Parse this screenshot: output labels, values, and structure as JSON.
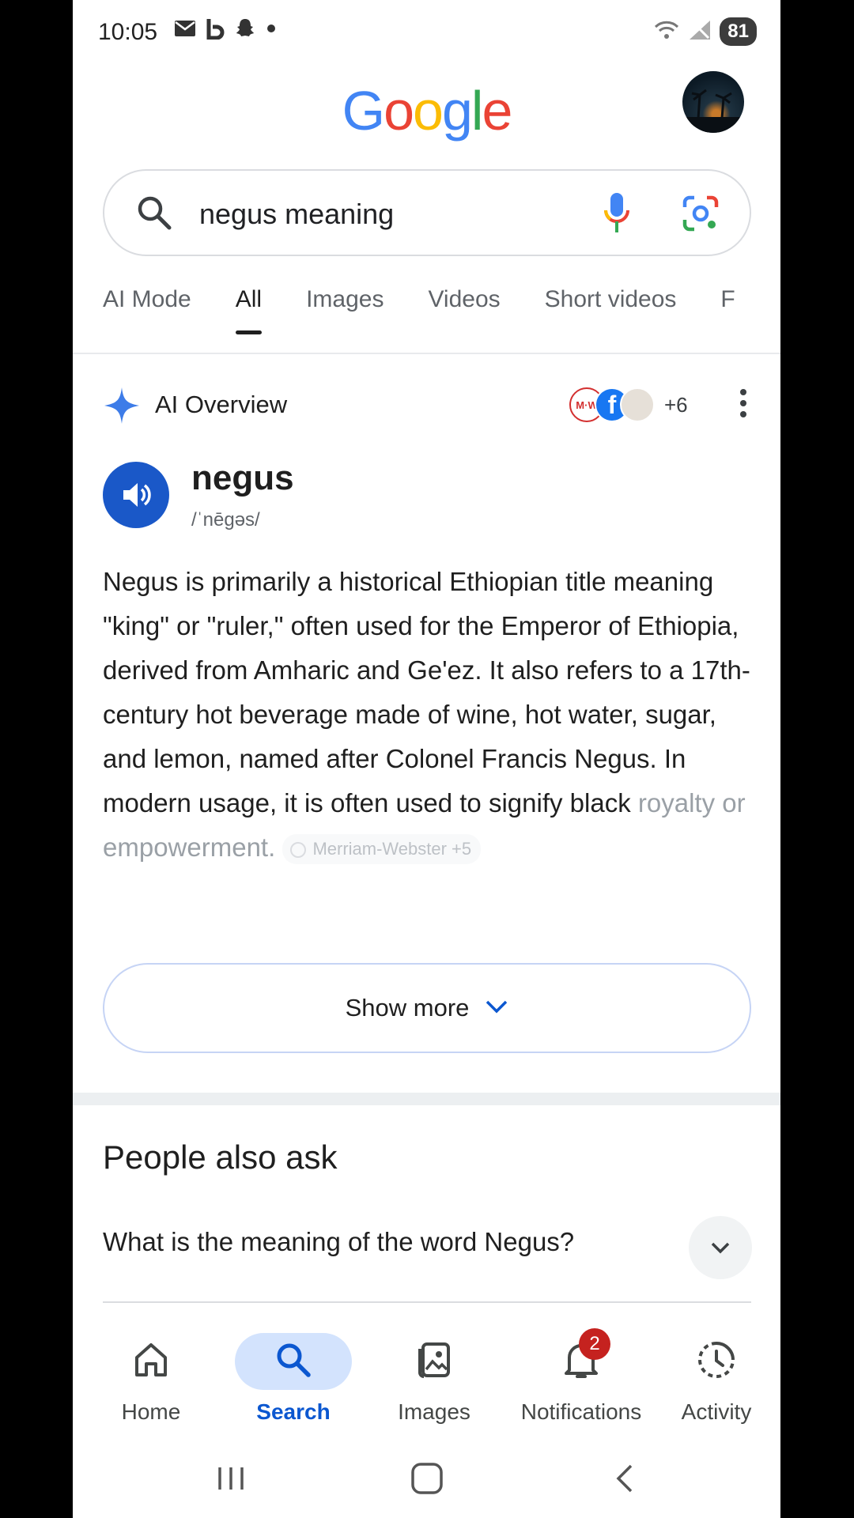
{
  "status_bar": {
    "time": "10:05",
    "battery": "81",
    "left_icons": [
      "mail-icon",
      "b-app-icon",
      "snapchat-icon",
      "dot-icon"
    ],
    "right_icons": [
      "wifi-icon",
      "signal-icon"
    ]
  },
  "header": {
    "logo_letters": [
      {
        "ch": "G",
        "color": "#4285F4"
      },
      {
        "ch": "o",
        "color": "#EA4335"
      },
      {
        "ch": "o",
        "color": "#FBBC05"
      },
      {
        "ch": "g",
        "color": "#4285F4"
      },
      {
        "ch": "l",
        "color": "#34A853"
      },
      {
        "ch": "e",
        "color": "#EA4335"
      }
    ]
  },
  "search": {
    "query": "negus meaning"
  },
  "tabs": [
    {
      "label": "AI Mode",
      "active": false
    },
    {
      "label": "All",
      "active": true
    },
    {
      "label": "Images",
      "active": false
    },
    {
      "label": "Videos",
      "active": false
    },
    {
      "label": "Short videos",
      "active": false
    },
    {
      "label": "F",
      "active": false
    }
  ],
  "ai_overview": {
    "title": "AI Overview",
    "sources_more": "+6",
    "source_favicons": [
      {
        "name": "merriam-webster-favicon",
        "text": "M·W"
      },
      {
        "name": "facebook-favicon",
        "text": "f"
      },
      {
        "name": "source-favicon",
        "text": ""
      }
    ],
    "word": "negus",
    "pronunciation": "/ˈnēɡəs/",
    "text": "Negus is primarily a historical Ethiopian title meaning \"king\" or \"ruler,\" often used for the Emperor of Ethiopia, derived from Amharic and Ge'ez. It also refers to a 17th-century hot beverage made of wine, hot water, sugar, and lemon, named after Colonel Francis Negus. In modern usage, it is often used to signify black",
    "text_faded": "royalty or empowerment.",
    "citation_chip": "Merriam-Webster +5",
    "show_more": "Show more"
  },
  "people_also_ask": {
    "title": "People also ask",
    "questions": [
      "What is the meaning of the word Negus?"
    ]
  },
  "bottom_nav": [
    {
      "label": "Home",
      "icon": "home-icon",
      "active": false
    },
    {
      "label": "Search",
      "icon": "search-icon",
      "active": true
    },
    {
      "label": "Images",
      "icon": "images-icon",
      "active": false
    },
    {
      "label": "Notifications",
      "icon": "bell-icon",
      "active": false,
      "badge": "2"
    },
    {
      "label": "Activity",
      "icon": "activity-icon",
      "active": false
    }
  ],
  "colors": {
    "accent_blue": "#0b57d0",
    "speaker_blue": "#1a58c8",
    "badge_red": "#c5221f"
  }
}
